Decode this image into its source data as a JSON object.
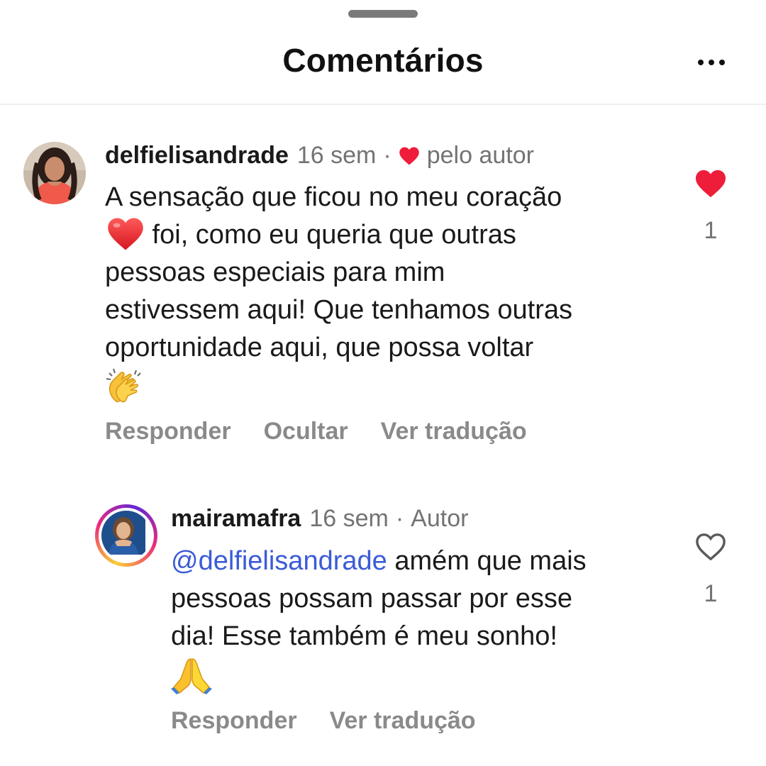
{
  "header": {
    "title": "Comentários",
    "more_icon": "more-horizontal-icon"
  },
  "comments": [
    {
      "username": "delfielisandrade",
      "time": "16 sem",
      "separator": "·",
      "liked_by_author_label": "pelo autor",
      "text_lines": [
        "A sensação que ficou no meu coração",
        " foi, como eu queria que outras",
        "pessoas especiais para mim",
        "estivessem aqui! Que tenhamos outras",
        "oportunidade aqui, que possa voltar"
      ],
      "emojis": [
        "red-heart-emoji",
        "clapping-hands-emoji"
      ],
      "actions": [
        "Responder",
        "Ocultar",
        "Ver tradução"
      ],
      "liked": true,
      "like_count": "1"
    },
    {
      "username": "mairamafra",
      "time": "16 sem",
      "separator": "·",
      "author_label": "Autor",
      "mention": "@delfielisandrade",
      "text_lines": [
        " amém que mais",
        "pessoas possam passar por esse",
        "dia! Esse também é meu sonho!"
      ],
      "emojis": [
        "folded-hands-emoji"
      ],
      "actions": [
        "Responder",
        "Ver tradução"
      ],
      "liked": false,
      "like_count": "1"
    }
  ],
  "colors": {
    "like_red": "#ee1d3a",
    "muted_text": "#737373",
    "mention_blue": "#3b5bd6"
  }
}
